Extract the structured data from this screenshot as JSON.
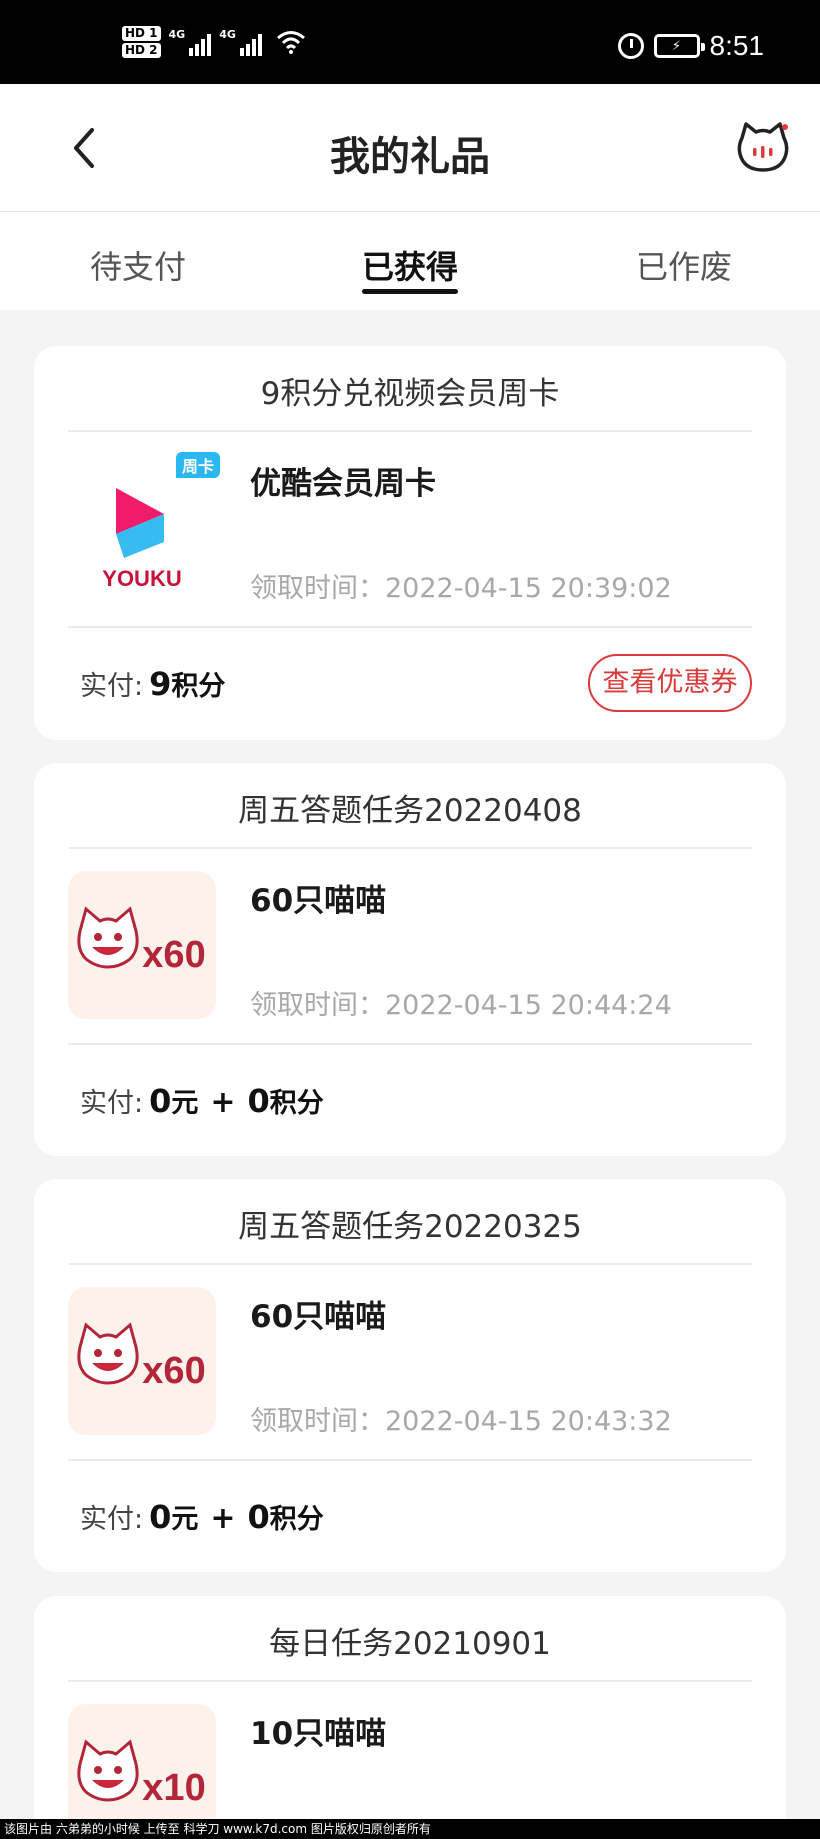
{
  "status_bar": {
    "hd1": "HD 1",
    "hd2": "HD 2",
    "net1": "4G",
    "net2": "4G",
    "battery_icon": "battery-charging-icon",
    "time": "8:51"
  },
  "header": {
    "title": "我的礼品",
    "back_icon": "chevron-left-icon",
    "mascot_icon": "cat-face-icon"
  },
  "tabs": [
    {
      "label": "待支付",
      "active": false
    },
    {
      "label": "已获得",
      "active": true
    },
    {
      "label": "已作废",
      "active": false
    }
  ],
  "colors": {
    "accent_red": "#d93a3a",
    "youku_blue": "#2bb8f0",
    "youku_pink": "#f01c6a"
  },
  "cards": [
    {
      "title": "9积分兑视频会员周卡",
      "item_name": "优酷会员周卡",
      "time_label": "领取时间：",
      "time_value": "2022-04-15 20:39:02",
      "pay_label": "实付:",
      "pay_amount": "9",
      "pay_unit": "积分",
      "badge": "周卡",
      "logo_text": "YOUKU",
      "button_label": "查看优惠券"
    },
    {
      "title": "周五答题任务20220408",
      "item_name": "60只喵喵",
      "time_label": "领取时间：",
      "time_value": "2022-04-15 20:44:24",
      "pay_label": "实付:",
      "cash": "0",
      "cash_unit": "元",
      "plus": "+",
      "points": "0",
      "points_unit": "积分",
      "multiplier": "x60"
    },
    {
      "title": "周五答题任务20220325",
      "item_name": "60只喵喵",
      "time_label": "领取时间：",
      "time_value": "2022-04-15 20:43:32",
      "pay_label": "实付:",
      "cash": "0",
      "cash_unit": "元",
      "plus": "+",
      "points": "0",
      "points_unit": "积分",
      "multiplier": "x60"
    },
    {
      "title": "每日任务20210901",
      "item_name": "10只喵喵",
      "multiplier": "x10"
    }
  ],
  "watermark": "该图片由 六弟弟的小时候 上传至 科学刀 www.k7d.com 图片版权归原创者所有"
}
